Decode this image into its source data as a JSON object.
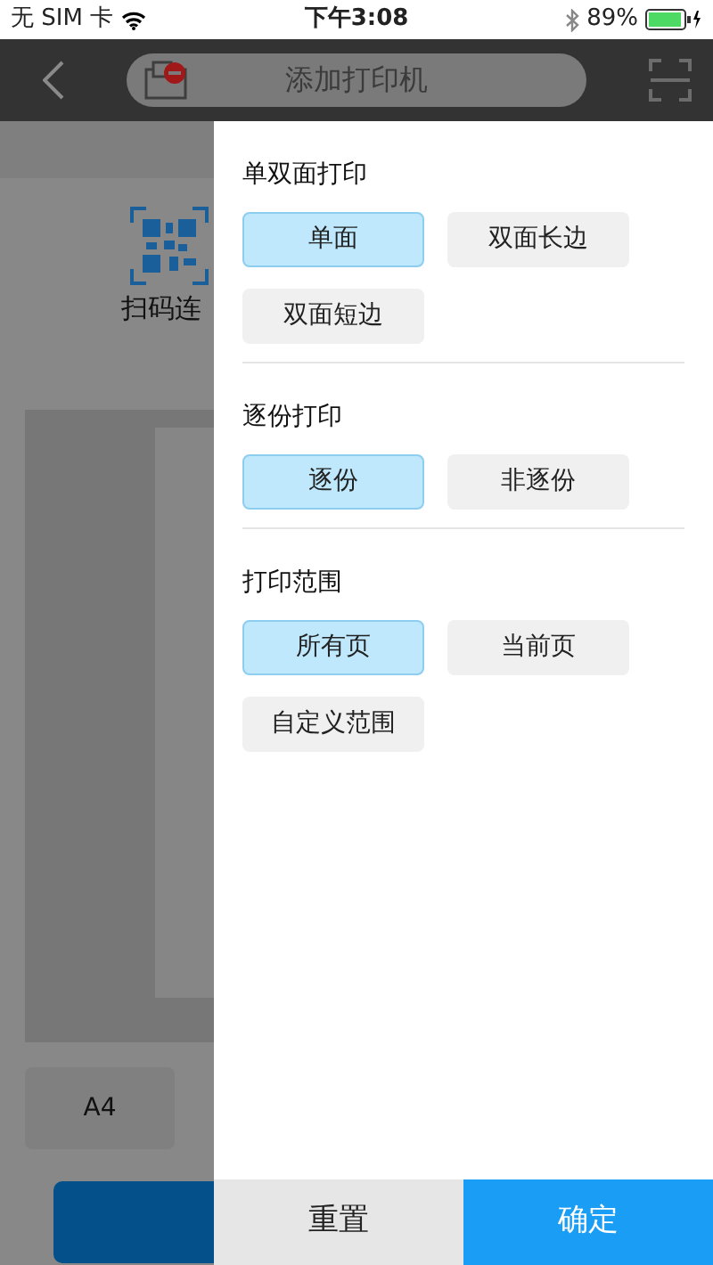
{
  "status_bar": {
    "carrier": "无 SIM 卡",
    "time": "下午3:08",
    "battery": "89%"
  },
  "nav_bar": {
    "search": {
      "placeholder": "添加打印机"
    }
  },
  "background": {
    "scan_label": "扫码连",
    "paper_size": "A4"
  },
  "drawer": {
    "sections": [
      {
        "title": "单双面打印",
        "options": [
          {
            "label": "单面",
            "selected": true
          },
          {
            "label": "双面长边",
            "selected": false
          },
          {
            "label": "双面短边",
            "selected": false
          }
        ]
      },
      {
        "title": "逐份打印",
        "options": [
          {
            "label": "逐份",
            "selected": true
          },
          {
            "label": "非逐份",
            "selected": false
          }
        ]
      },
      {
        "title": "打印范围",
        "options": [
          {
            "label": "所有页",
            "selected": true
          },
          {
            "label": "当前页",
            "selected": false
          },
          {
            "label": "自定义范围",
            "selected": false
          }
        ]
      }
    ],
    "buttons": [
      {
        "label": "重置",
        "kind": "secondary"
      },
      {
        "label": "确定",
        "kind": "primary"
      }
    ]
  }
}
